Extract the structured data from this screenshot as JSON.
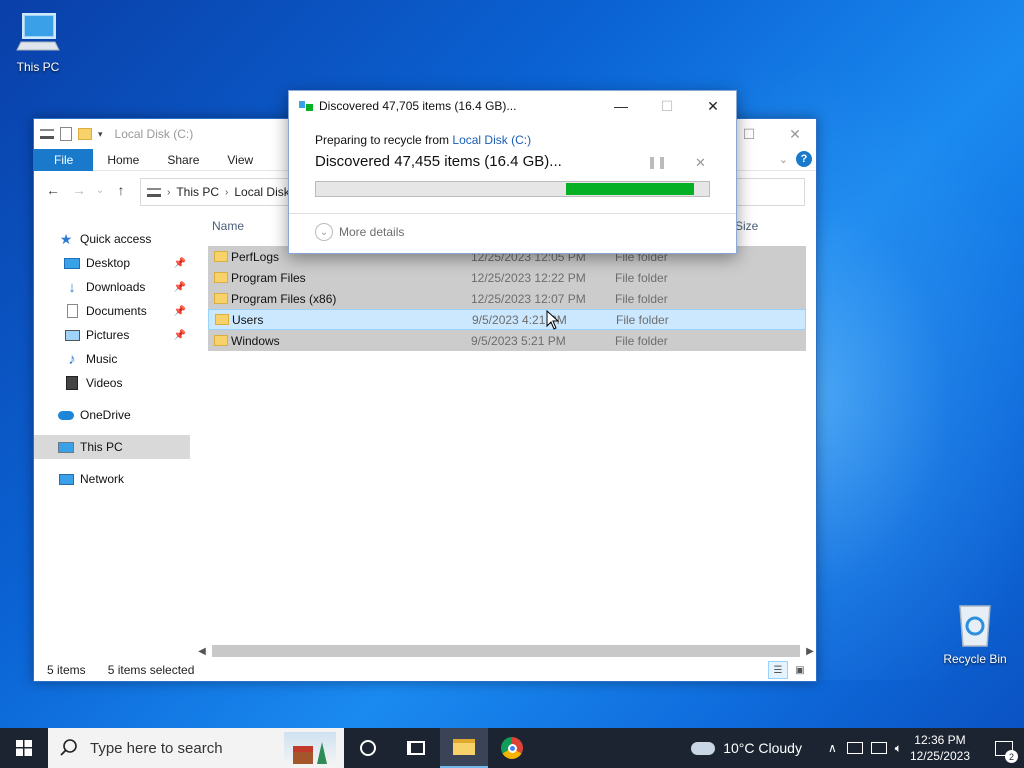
{
  "desktop": {
    "this_pc_label": "This PC",
    "recycle_bin_label": "Recycle Bin"
  },
  "explorer": {
    "title": "Local Disk (C:)",
    "ribbon_tabs": [
      "File",
      "Home",
      "Share",
      "View"
    ],
    "breadcrumb": [
      "This PC",
      "Local Disk (C:)"
    ],
    "columns": {
      "name": "Name",
      "size": "Size"
    },
    "sidebar": [
      {
        "label": "Quick access",
        "icon": "star-icon",
        "pinned": false
      },
      {
        "label": "Desktop",
        "icon": "desktop-icon",
        "pinned": true
      },
      {
        "label": "Downloads",
        "icon": "download-icon",
        "pinned": true
      },
      {
        "label": "Documents",
        "icon": "document-icon",
        "pinned": true
      },
      {
        "label": "Pictures",
        "icon": "picture-icon",
        "pinned": true
      },
      {
        "label": "Music",
        "icon": "music-icon",
        "pinned": false
      },
      {
        "label": "Videos",
        "icon": "video-icon",
        "pinned": false
      },
      {
        "label": "OneDrive",
        "icon": "cloud-icon",
        "pinned": false
      },
      {
        "label": "This PC",
        "icon": "computer-icon",
        "pinned": false
      },
      {
        "label": "Network",
        "icon": "network-icon",
        "pinned": false
      }
    ],
    "files": [
      {
        "name": "PerfLogs",
        "date": "12/25/2023 12:05 PM",
        "type": "File folder"
      },
      {
        "name": "Program Files",
        "date": "12/25/2023 12:22 PM",
        "type": "File folder"
      },
      {
        "name": "Program Files (x86)",
        "date": "12/25/2023 12:07 PM",
        "type": "File folder"
      },
      {
        "name": "Users",
        "date": "9/5/2023 4:21 PM",
        "type": "File folder"
      },
      {
        "name": "Windows",
        "date": "9/5/2023 5:21 PM",
        "type": "File folder"
      }
    ],
    "status": {
      "items": "5 items",
      "selected": "5 items selected"
    }
  },
  "dialog": {
    "title": "Discovered 47,705 items (16.4 GB)...",
    "preparing_prefix": "Preparing to recycle from ",
    "preparing_link": "Local Disk (C:)",
    "discovered": "Discovered 47,455 items (16.4 GB)...",
    "progress_start": 0.636,
    "progress_end": 0.962,
    "more_details": "More details",
    "progress_color": "#06b025"
  },
  "taskbar": {
    "search_placeholder": "Type here to search",
    "weather": "10°C  Cloudy",
    "time": "12:36 PM",
    "date": "12/25/2023",
    "notification_count": "2"
  }
}
